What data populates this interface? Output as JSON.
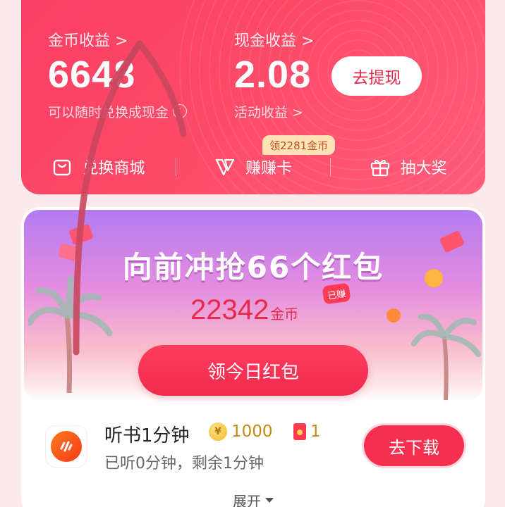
{
  "earnings": {
    "coins_title": "金币收益 >",
    "coins_value": "6648",
    "coins_note": "可以随时兑换成现金",
    "cash_title": "现金收益 >",
    "cash_value": "2.08",
    "cash_note": "活动收益 >",
    "withdraw_label": "去提现"
  },
  "quick_bar": {
    "items": [
      {
        "label": "兑换商城",
        "icon": "shopping-bag-icon"
      },
      {
        "label": "赚赚卡",
        "icon": "v-card-icon"
      },
      {
        "label": "抽大奖",
        "icon": "gift-icon"
      }
    ],
    "promo_badge": "领2281金币"
  },
  "banner": {
    "title": "向前冲抢66个红包",
    "amount": "22342",
    "amount_unit": "金币",
    "earned_tag": "已赚",
    "claim_label": "领今日红包"
  },
  "task": {
    "title": "听书1分钟",
    "coin_reward": "1000",
    "packet_reward": "1",
    "subtitle": "已听0分钟，剩余1分钟",
    "action_label": "去下载",
    "app_icon": "audiobook-app-icon"
  },
  "expand_label": "展开",
  "colors": {
    "accent": "#fb3e64",
    "button": "#f5304f",
    "coin": "#c68a14"
  }
}
